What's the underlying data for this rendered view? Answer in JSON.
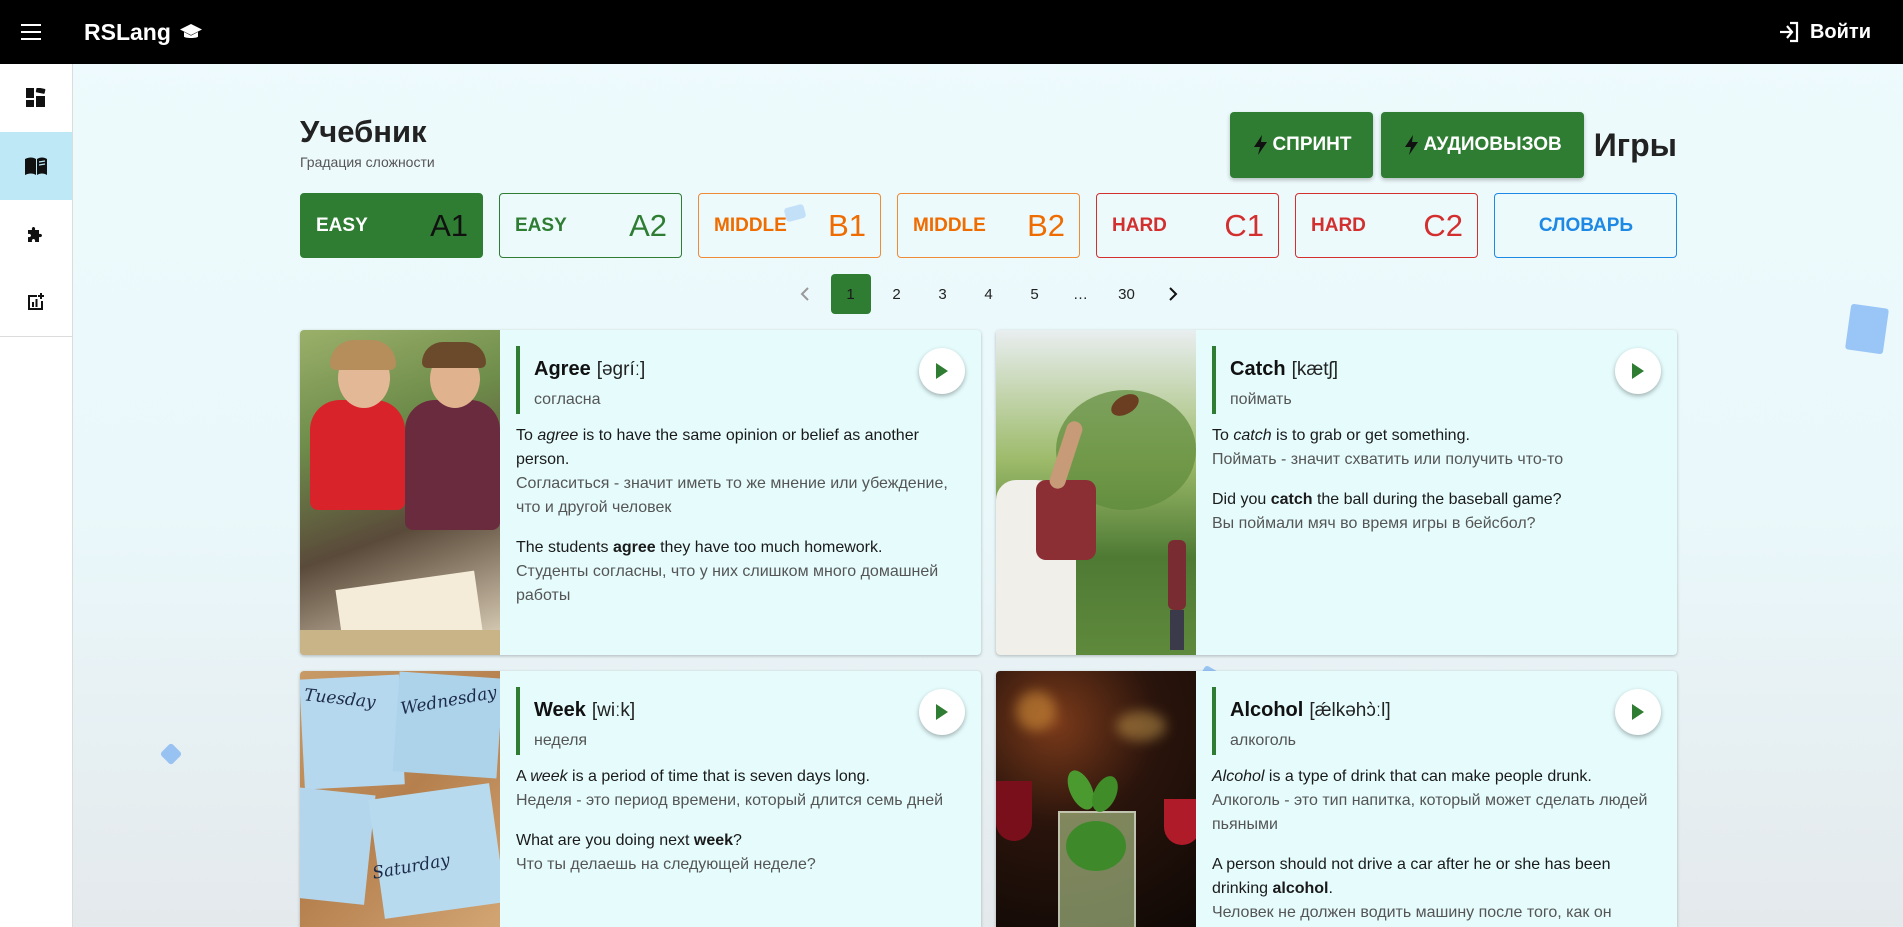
{
  "header": {
    "brand": "RSLang",
    "login_label": "Войти"
  },
  "sidebar": {
    "items": [
      {
        "name": "dashboard-icon"
      },
      {
        "name": "book-icon",
        "active": true
      },
      {
        "name": "puzzle-icon"
      },
      {
        "name": "statistics-icon"
      }
    ]
  },
  "page": {
    "title": "Учебник",
    "subtitle": "Градация сложности",
    "games_label": "Игры",
    "game_buttons": [
      "СПРИНТ",
      "АУДИОВЫЗОВ"
    ]
  },
  "levels": [
    {
      "name": "EASY",
      "code": "A1",
      "active": true
    },
    {
      "name": "EASY",
      "code": "A2"
    },
    {
      "name": "MIDDLE",
      "code": "B1"
    },
    {
      "name": "MIDDLE",
      "code": "B2"
    },
    {
      "name": "HARD",
      "code": "C1"
    },
    {
      "name": "HARD",
      "code": "C2"
    },
    {
      "name": "СЛОВАРЬ"
    }
  ],
  "pagination": {
    "pages": [
      "1",
      "2",
      "3",
      "4",
      "5",
      "…",
      "30"
    ],
    "current": "1"
  },
  "cards": [
    {
      "word": "Agree",
      "transcription": "[əgríː]",
      "translation": "согласна",
      "meaning_parts": [
        "To ",
        "agree",
        " is to have the same opinion or belief as another person."
      ],
      "meaning_ru": "Согласиться - значит иметь то же мнение или убеждение, что и другой человек",
      "example_parts": [
        "The students ",
        "agree",
        " they have too much homework."
      ],
      "example_ru": "Студенты согласны, что у них слишком много домашней работы"
    },
    {
      "word": "Catch",
      "transcription": "[kætʃ]",
      "translation": "поймать",
      "meaning_parts": [
        "To ",
        "catch",
        " is to grab or get something."
      ],
      "meaning_ru": "Поймать - значит схватить или получить что-то",
      "example_parts": [
        "Did you ",
        "catch",
        " the ball during the baseball game?"
      ],
      "example_ru": "Вы поймали мяч во время игры в бейсбол?"
    },
    {
      "word": "Week",
      "transcription": "[wiːk]",
      "translation": "неделя",
      "meaning_parts": [
        "A ",
        "week",
        " is a period of time that is seven days long."
      ],
      "meaning_ru": "Неделя - это период времени, который длится семь дней",
      "example_parts": [
        "What are you doing next ",
        "week",
        "?"
      ],
      "example_ru": "Что ты делаешь на следующей неделе?",
      "image_labels": [
        "Tuesday",
        "Wednesday",
        "Saturday"
      ]
    },
    {
      "word": "Alcohol",
      "transcription": "[ǽlkəhɔ̀ːl]",
      "translation": "алкоголь",
      "meaning_parts": [
        "",
        "Alcohol",
        " is a type of drink that can make people drunk."
      ],
      "meaning_ru": "Алкоголь - это тип напитка, который может сделать людей пьяными",
      "example_parts": [
        "A person should not drive a car after he or she has been drinking ",
        "alcohol",
        "."
      ],
      "example_ru": "Человек не должен водить машину после того, как он"
    }
  ],
  "colors": {
    "accent_green": "#2e7d32",
    "middle_orange": "#ef6c00",
    "hard_red": "#d32f2f",
    "dict_blue": "#1e88e5"
  }
}
